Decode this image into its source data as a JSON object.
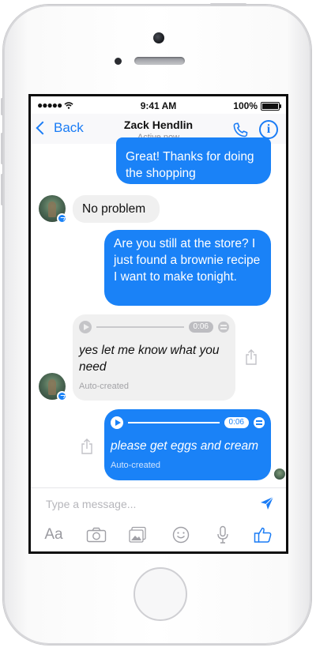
{
  "status_bar": {
    "signal": "●●●●● ",
    "time": "9:41 AM",
    "battery": "100%"
  },
  "nav": {
    "back_label": "Back",
    "contact_name": "Zack Hendlin",
    "contact_status": "Active now",
    "call_icon": "phone-icon",
    "info_icon": "info-icon",
    "info_glyph": "i"
  },
  "colors": {
    "accent": "#1a7cf5",
    "outgoing_bubble": "#1a82f7",
    "incoming_bubble": "#f0f0f0"
  },
  "messages": [
    {
      "direction": "outgoing",
      "type": "text",
      "text": "Great! Thanks for doing the shopping"
    },
    {
      "direction": "incoming",
      "type": "text",
      "text": "No problem"
    },
    {
      "direction": "outgoing",
      "type": "text",
      "text": "Are you still at the store? I just found a brownie recipe I want to make tonight."
    },
    {
      "direction": "incoming",
      "type": "audio",
      "duration": "0:06",
      "transcript": "yes let me know what you need",
      "note": "Auto-created"
    },
    {
      "direction": "outgoing",
      "type": "audio",
      "duration": "0:06",
      "transcript": "please get eggs and cream",
      "note": "Auto-created"
    }
  ],
  "composer": {
    "placeholder": "Type a message...",
    "tools": [
      {
        "name": "text-format",
        "label": "Aa"
      },
      {
        "name": "camera-icon"
      },
      {
        "name": "gallery-icon"
      },
      {
        "name": "emoji-icon"
      },
      {
        "name": "microphone-icon"
      },
      {
        "name": "like-icon"
      }
    ]
  }
}
